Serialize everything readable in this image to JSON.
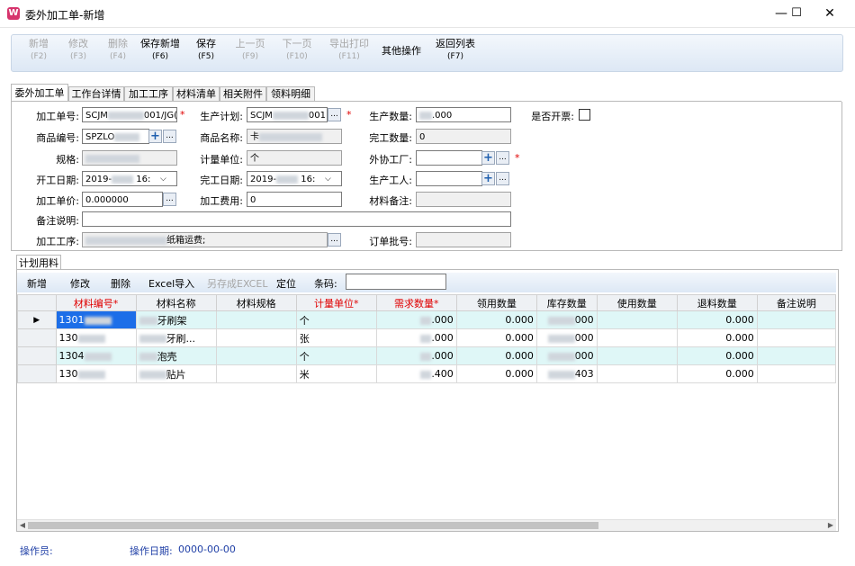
{
  "window": {
    "title": "委外加工单-新增",
    "icon": "W",
    "minimize": "—",
    "maximize": "☐",
    "close": "✕"
  },
  "toolbar": [
    {
      "label": "新增",
      "key": "(F2)",
      "enabled": false
    },
    {
      "label": "修改",
      "key": "(F3)",
      "enabled": false
    },
    {
      "label": "删除",
      "key": "(F4)",
      "enabled": false
    },
    {
      "label": "保存新增",
      "key": "(F6)",
      "enabled": true
    },
    {
      "label": "保存",
      "key": "(F5)",
      "enabled": true
    },
    {
      "label": "上一页",
      "key": "(F9)",
      "enabled": false
    },
    {
      "label": "下一页",
      "key": "(F10)",
      "enabled": false
    },
    {
      "label": "导出打印",
      "key": "(F11)",
      "enabled": false
    },
    {
      "label": "其他操作",
      "key": "",
      "enabled": true
    },
    {
      "label": "返回列表",
      "key": "(F7)",
      "enabled": true
    }
  ],
  "tabs": [
    "委外加工单",
    "工作台详情",
    "加工工序",
    "材料清单",
    "相关附件",
    "领料明细"
  ],
  "form": {
    "order_no_label": "加工单号:",
    "order_no_value": "SCJM",
    "order_no_suffix": "001/JG(",
    "plan_label": "生产计划:",
    "plan_value": "SCJM",
    "plan_suffix": "001",
    "qty_label": "生产数量:",
    "qty_value": ".000",
    "invoice_label": "是否开票:",
    "product_code_label": "商品编号:",
    "product_code_value": "SPZLO",
    "product_name_label": "商品名称:",
    "product_name_value": "卡",
    "done_qty_label": "完工数量:",
    "done_qty_value": "0",
    "spec_label": "规格:",
    "spec_value": "",
    "unit_label": "计量单位:",
    "unit_value": "个",
    "vendor_label": "外协工厂:",
    "vendor_value": "",
    "start_label": "开工日期:",
    "start_value": "2019-",
    "start_suffix": "16:",
    "finish_label": "完工日期:",
    "finish_value": "2019-",
    "finish_suffix": "16:",
    "worker_label": "生产工人:",
    "worker_value": "",
    "price_label": "加工单价:",
    "price_value": "0.000000",
    "fee_label": "加工费用:",
    "fee_value": "0",
    "material_note_label": "材料备注:",
    "material_note_value": "",
    "remark_label": "备注说明:",
    "remark_value": "",
    "process_label": "加工工序:",
    "process_value": "纸箱运费;",
    "batch_label": "订单批号:",
    "batch_value": "",
    "required_mark": "*",
    "ellipsis": "...",
    "plus": "+"
  },
  "subtab": "计划用料",
  "grid_toolbar": {
    "buttons": [
      {
        "label": "新增",
        "enabled": true
      },
      {
        "label": "修改",
        "enabled": true
      },
      {
        "label": "删除",
        "enabled": true
      },
      {
        "label": "Excel导入",
        "enabled": true
      },
      {
        "label": "另存成EXCEL",
        "enabled": false
      },
      {
        "label": "定位",
        "enabled": true
      }
    ],
    "barcode_label": "条码:",
    "barcode_value": ""
  },
  "grid": {
    "columns": [
      {
        "label": "材料编号*",
        "required": true
      },
      {
        "label": "材料名称",
        "required": false
      },
      {
        "label": "材料规格",
        "required": false
      },
      {
        "label": "计量单位*",
        "required": true
      },
      {
        "label": "需求数量*",
        "required": true
      },
      {
        "label": "领用数量",
        "required": false
      },
      {
        "label": "库存数量",
        "required": false
      },
      {
        "label": "使用数量",
        "required": false
      },
      {
        "label": "退料数量",
        "required": false
      },
      {
        "label": "备注说明",
        "required": false
      }
    ],
    "current_row_marker": "▶",
    "rows": [
      {
        "code": "1301",
        "name": "牙刷架",
        "spec": "",
        "unit": "个",
        "demand": ".000",
        "issued": "0.000",
        "stock": "000",
        "used": "",
        "returned": "0.000",
        "note": ""
      },
      {
        "code": "130",
        "name": "牙刷...",
        "spec": "",
        "unit": "张",
        "demand": ".000",
        "issued": "0.000",
        "stock": "000",
        "used": "",
        "returned": "0.000",
        "note": ""
      },
      {
        "code": "1304",
        "name": "泡壳",
        "spec": "",
        "unit": "个",
        "demand": ".000",
        "issued": "0.000",
        "stock": "000",
        "used": "",
        "returned": "0.000",
        "note": ""
      },
      {
        "code": "130",
        "name": "贴片",
        "spec": "",
        "unit": "米",
        "demand": ".400",
        "issued": "0.000",
        "stock": "403",
        "used": "",
        "returned": "0.000",
        "note": ""
      }
    ]
  },
  "status": {
    "operator_label": "操作员:",
    "operator_value": "",
    "date_label": "操作日期:",
    "date_value": "0000-00-00"
  },
  "colors": {
    "accent": "#1c6ee8",
    "required": "#e00000",
    "row_alt": "#dff7f7",
    "status_text": "#1f3fa6"
  }
}
